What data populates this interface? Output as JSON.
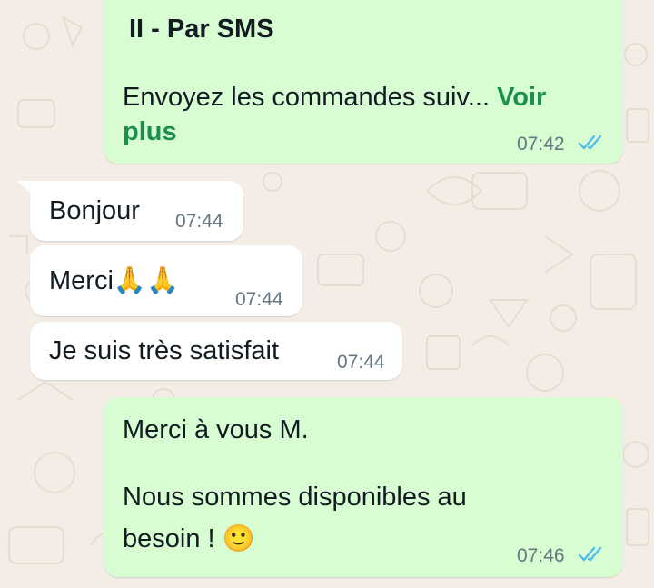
{
  "messages": [
    {
      "direction": "outgoing",
      "heading": "II - Par SMS",
      "text": "Envoyez les commandes suiv...",
      "more_label_1": "Voir",
      "more_label_2": "plus",
      "time": "07:42",
      "status": "read"
    },
    {
      "direction": "incoming",
      "text": "Bonjour",
      "time": "07:44"
    },
    {
      "direction": "incoming",
      "text": "Merci",
      "emoji": "🙏🙏",
      "time": "07:44"
    },
    {
      "direction": "incoming",
      "text": "Je suis très satisfait",
      "time": "07:44"
    },
    {
      "direction": "outgoing",
      "line1": "Merci à vous M.",
      "line2": "Nous sommes disponibles au",
      "line3": "besoin !",
      "emoji": "🙂",
      "time": "07:46",
      "status": "read"
    }
  ],
  "colors": {
    "outgoing_bubble": "#d9fdd3",
    "incoming_bubble": "#ffffff",
    "background": "#f3ede6",
    "read_ticks": "#53bdeb",
    "see_more": "#1a8f4f"
  },
  "icons": {
    "read_receipt": "double-check-icon"
  }
}
